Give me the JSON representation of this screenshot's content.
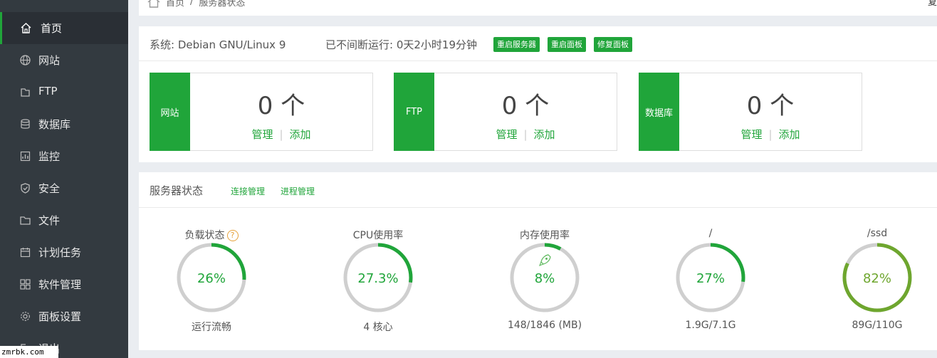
{
  "sidebar": {
    "items": [
      {
        "label": "首页",
        "icon": "home-icon",
        "active": true
      },
      {
        "label": "网站",
        "icon": "globe-icon"
      },
      {
        "label": "FTP",
        "icon": "ftp-icon"
      },
      {
        "label": "数据库",
        "icon": "database-icon"
      },
      {
        "label": "监控",
        "icon": "monitor-icon"
      },
      {
        "label": "安全",
        "icon": "shield-icon"
      },
      {
        "label": "文件",
        "icon": "folder-icon"
      },
      {
        "label": "计划任务",
        "icon": "calendar-icon"
      },
      {
        "label": "软件管理",
        "icon": "grid-icon"
      },
      {
        "label": "面板设置",
        "icon": "gear-icon"
      },
      {
        "label": "退出",
        "icon": "logout-icon"
      }
    ]
  },
  "watermark": "zmrbk.com",
  "breadcrumb": {
    "home": "首页",
    "separator": "/",
    "current": "服务器状态"
  },
  "topright": "复",
  "system": {
    "os": "系统: Debian GNU/Linux 9",
    "uptime": "已不间断运行: 0天2小时19分钟",
    "buttons": [
      "重启服务器",
      "重启面板",
      "修复面板"
    ]
  },
  "cards": [
    {
      "tag": "网站",
      "count": "0 个",
      "manage": "管理",
      "add": "添加"
    },
    {
      "tag": "FTP",
      "count": "0 个",
      "manage": "管理",
      "add": "添加"
    },
    {
      "tag": "数据库",
      "count": "0 个",
      "manage": "管理",
      "add": "添加"
    }
  ],
  "status": {
    "title": "服务器状态",
    "links": [
      "连接管理",
      "进程管理"
    ]
  },
  "gauges": [
    {
      "title": "负载状态",
      "value": "26%",
      "percent": 26,
      "sub": "运行流畅",
      "help": "?",
      "color": "#20a53a"
    },
    {
      "title": "CPU使用率",
      "value": "27.3%",
      "percent": 27.3,
      "sub": "4 核心",
      "color": "#20a53a"
    },
    {
      "title": "内存使用率",
      "value": "8%",
      "percent": 8,
      "sub": "148/1846 (MB)",
      "color": "#20a53a",
      "icon": "rocket-icon"
    },
    {
      "title": "/",
      "value": "27%",
      "percent": 27,
      "sub": "1.9G/7.1G",
      "color": "#20a53a"
    },
    {
      "title": "/ssd",
      "value": "82%",
      "percent": 82,
      "sub": "89G/110G",
      "color": "#6ea62e"
    }
  ],
  "colors": {
    "accent": "#20a53a",
    "sidebar": "#333a40",
    "track": "#cfcfcf"
  }
}
